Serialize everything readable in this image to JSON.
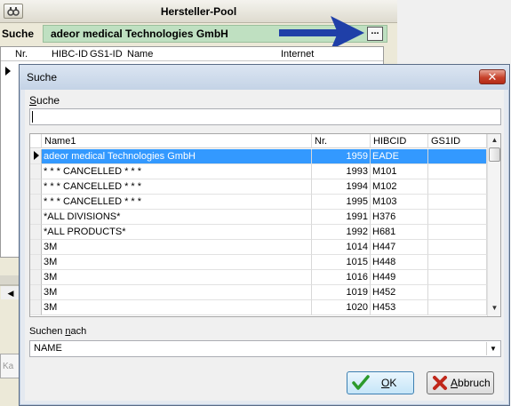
{
  "background_window": {
    "title": "Hersteller-Pool",
    "search_label": "Suche",
    "search_value": "adeor medical Technologies GmbH",
    "ellipsis_label": "...",
    "columns": [
      "Nr.",
      "HIBC-ID",
      "GS1-ID",
      "Name",
      "Internet"
    ],
    "fragment_text": "Ka"
  },
  "dialog": {
    "title": "Suche",
    "close_glyph": "✕",
    "search_label_underlined": "S",
    "search_label_rest": "uche",
    "search_value": "",
    "columns": {
      "name": "Name1",
      "nr": "Nr.",
      "hibc": "HIBCID",
      "gs1": "GS1ID"
    },
    "rows": [
      {
        "name": "adeor medical Technologies GmbH",
        "nr": "1959",
        "hibc": "EADE",
        "gs1": "",
        "selected": true
      },
      {
        "name": "* * * CANCELLED * * *",
        "nr": "1993",
        "hibc": "M101",
        "gs1": ""
      },
      {
        "name": "* * * CANCELLED * * *",
        "nr": "1994",
        "hibc": "M102",
        "gs1": ""
      },
      {
        "name": "* * * CANCELLED * * *",
        "nr": "1995",
        "hibc": "M103",
        "gs1": ""
      },
      {
        "name": "*ALL DIVISIONS*",
        "nr": "1991",
        "hibc": "H376",
        "gs1": ""
      },
      {
        "name": "*ALL PRODUCTS*",
        "nr": "1992",
        "hibc": "H681",
        "gs1": ""
      },
      {
        "name": "3M",
        "nr": "1014",
        "hibc": "H447",
        "gs1": ""
      },
      {
        "name": "3M",
        "nr": "1015",
        "hibc": "H448",
        "gs1": ""
      },
      {
        "name": "3M",
        "nr": "1016",
        "hibc": "H449",
        "gs1": ""
      },
      {
        "name": "3M",
        "nr": "1019",
        "hibc": "H452",
        "gs1": ""
      },
      {
        "name": "3M",
        "nr": "1020",
        "hibc": "H453",
        "gs1": ""
      }
    ],
    "search_by_label_start": "Suchen ",
    "search_by_label_underlined": "n",
    "search_by_label_end": "ach",
    "search_by_value": "NAME",
    "ok_underlined": "O",
    "ok_rest": "K",
    "cancel_underlined": "A",
    "cancel_rest": "bbruch"
  },
  "icons": {
    "row_indicator": "row-pointer-icon",
    "ok": "checkmark-icon",
    "cancel": "x-icon",
    "arrow": "blue-arrow-icon"
  },
  "colors": {
    "selection": "#3399ff",
    "search_bar_bg": "#bfe0c1",
    "arrow": "#1f3fa8",
    "ok_check": "#2c9a2c",
    "cancel_x": "#c0271a"
  }
}
